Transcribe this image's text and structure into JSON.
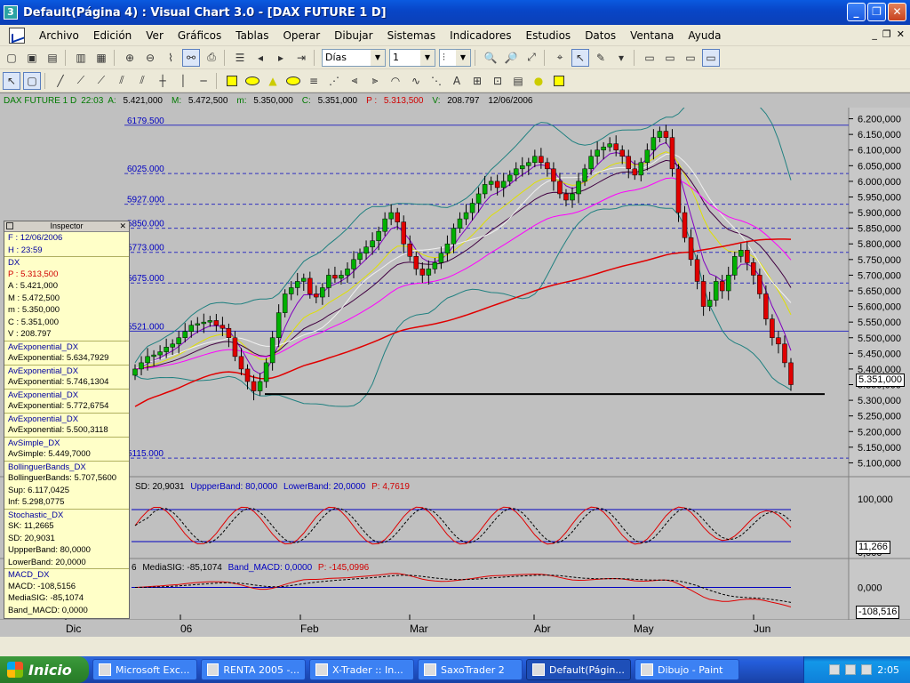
{
  "window": {
    "title": "Default(Página 4) : Visual Chart  3.0 - [DAX FUTURE 1 D]",
    "app_icon_text": "3"
  },
  "menu": [
    "Archivo",
    "Edición",
    "Ver",
    "Gráficos",
    "Tablas",
    "Operar",
    "Dibujar",
    "Sistemas",
    "Indicadores",
    "Estudios",
    "Datos",
    "Ventana",
    "Ayuda"
  ],
  "toolbar": {
    "period_value": "Días",
    "interval_value": "1"
  },
  "infobar": {
    "label": "DAX FUTURE 1 D",
    "time": "22:03",
    "a_label": "A:",
    "a_value": "5.421,000",
    "m_label": "M:",
    "m_value": "5.472,500",
    "n_label": "m:",
    "n_value": "5.350,000",
    "c_label": "C:",
    "c_value": "5.351,000",
    "p_label": "P :",
    "p_value": "5.313,500",
    "v_label": "V:",
    "v_value": "208.797",
    "date": "12/06/2006"
  },
  "inspector": {
    "title": "Inspector",
    "rows": [
      {
        "text": "F : 12/06/2006",
        "style": "blue"
      },
      {
        "text": "H : 23:59",
        "style": "blue"
      },
      {
        "text": "DX",
        "style": "blue sec"
      },
      {
        "text": "P : 5.313,500",
        "style": "red"
      },
      {
        "text": "A : 5.421,000",
        "style": ""
      },
      {
        "text": "M : 5.472,500",
        "style": ""
      },
      {
        "text": "m : 5.350,000",
        "style": ""
      },
      {
        "text": "C : 5.351,000",
        "style": ""
      },
      {
        "text": "V : 208.797",
        "style": ""
      },
      {
        "text": "AvExponential_DX",
        "style": "blue sec"
      },
      {
        "text": "AvExponential: 5.634,7929",
        "style": ""
      },
      {
        "text": "AvExponential_DX",
        "style": "blue sec"
      },
      {
        "text": "AvExponential: 5.746,1304",
        "style": ""
      },
      {
        "text": "AvExponential_DX",
        "style": "blue sec"
      },
      {
        "text": "AvExponential: 5.772,6754",
        "style": ""
      },
      {
        "text": "AvExponential_DX",
        "style": "blue sec"
      },
      {
        "text": "AvExponential: 5.500,3118",
        "style": ""
      },
      {
        "text": "AvSimple_DX",
        "style": "blue sec"
      },
      {
        "text": "AvSimple: 5.449,7000",
        "style": ""
      },
      {
        "text": "BollinguerBands_DX",
        "style": "blue sec"
      },
      {
        "text": "BollinguerBands: 5.707,5600",
        "style": ""
      },
      {
        "text": "Sup: 6.117,0425",
        "style": ""
      },
      {
        "text": "Inf: 5.298,0775",
        "style": ""
      },
      {
        "text": "Stochastic_DX",
        "style": "blue sec"
      },
      {
        "text": "SK: 11,2665",
        "style": ""
      },
      {
        "text": "SD: 20,9031",
        "style": ""
      },
      {
        "text": "UppperBand: 80,0000",
        "style": ""
      },
      {
        "text": "LowerBand: 20,0000",
        "style": ""
      },
      {
        "text": "MACD_DX",
        "style": "blue sec"
      },
      {
        "text": "MACD: -108,5156",
        "style": ""
      },
      {
        "text": "MediaSIG: -85,1074",
        "style": ""
      },
      {
        "text": "Band_MACD: 0,0000",
        "style": ""
      }
    ]
  },
  "stoch_header": {
    "sd": "SD: 20,9031",
    "upper": "UppperBand: 80,0000",
    "lower": "LowerBand: 20,0000",
    "p": "P: 4,7619"
  },
  "macd_header": {
    "prefix": "6",
    "sig": "MediaSIG: -85,1074",
    "band": "Band_MACD: 0,0000",
    "p": "P: -145,0996"
  },
  "price_tags": {
    "last": "5.351,000",
    "stoch": "11,266",
    "macd": "-108,516"
  },
  "chart_data": {
    "type": "candlestick",
    "instrument": "DAX FUTURE 1 D",
    "x_labels": [
      "Dic",
      "06",
      "Feb",
      "Mar",
      "Abr",
      "May",
      "Jun"
    ],
    "y_ticks": [
      "6.200,000",
      "6.150,000",
      "6.100,000",
      "6.050,000",
      "6.000,000",
      "5.950,000",
      "5.900,000",
      "5.850,000",
      "5.800,000",
      "5.750,000",
      "5.700,000",
      "5.650,000",
      "5.600,000",
      "5.550,000",
      "5.500,000",
      "5.450,000",
      "5.400,000",
      "5.350,000",
      "5.300,000",
      "5.250,000",
      "5.200,000",
      "5.150,000",
      "5.100,000"
    ],
    "ylim": [
      5070,
      6230
    ],
    "horizontal_levels": [
      {
        "label": "6179.500",
        "value": 6179.5
      },
      {
        "label": "6025.000",
        "value": 6025
      },
      {
        "label": "5927.000",
        "value": 5927
      },
      {
        "label": "5850.000",
        "value": 5850
      },
      {
        "label": "5773.000",
        "value": 5773
      },
      {
        "label": "5675.000",
        "value": 5675
      },
      {
        "label": "5521.000",
        "value": 5521
      },
      {
        "label": "5115.000",
        "value": 5115
      }
    ],
    "support_line": 5320,
    "stochastic": {
      "y_ticks": [
        "100,000",
        "0,000"
      ],
      "upper_band": 80,
      "lower_band": 20
    },
    "macd": {
      "y_ticks": [
        "0,000"
      ],
      "band": 0
    },
    "closes": [
      5400,
      5420,
      5440,
      5445,
      5455,
      5470,
      5480,
      5500,
      5520,
      5540,
      5545,
      5550,
      5555,
      5540,
      5530,
      5500,
      5440,
      5400,
      5360,
      5330,
      5360,
      5420,
      5500,
      5580,
      5640,
      5660,
      5680,
      5690,
      5640,
      5630,
      5660,
      5700,
      5690,
      5700,
      5720,
      5750,
      5770,
      5790,
      5810,
      5840,
      5880,
      5900,
      5870,
      5800,
      5760,
      5720,
      5700,
      5720,
      5740,
      5770,
      5800,
      5850,
      5880,
      5900,
      5930,
      5960,
      5990,
      6000,
      5980,
      6000,
      6020,
      6040,
      6050,
      6060,
      6080,
      6060,
      6040,
      6000,
      5960,
      5940,
      5960,
      6000,
      6040,
      6080,
      6100,
      6110,
      6120,
      6100,
      6080,
      6040,
      6020,
      6060,
      6100,
      6140,
      6160,
      6140,
      6040,
      5900,
      5820,
      5750,
      5680,
      5600,
      5620,
      5680,
      5650,
      5700,
      5760,
      5780,
      5740,
      5700,
      5640,
      5560,
      5500,
      5480,
      5420,
      5350
    ]
  }
}
